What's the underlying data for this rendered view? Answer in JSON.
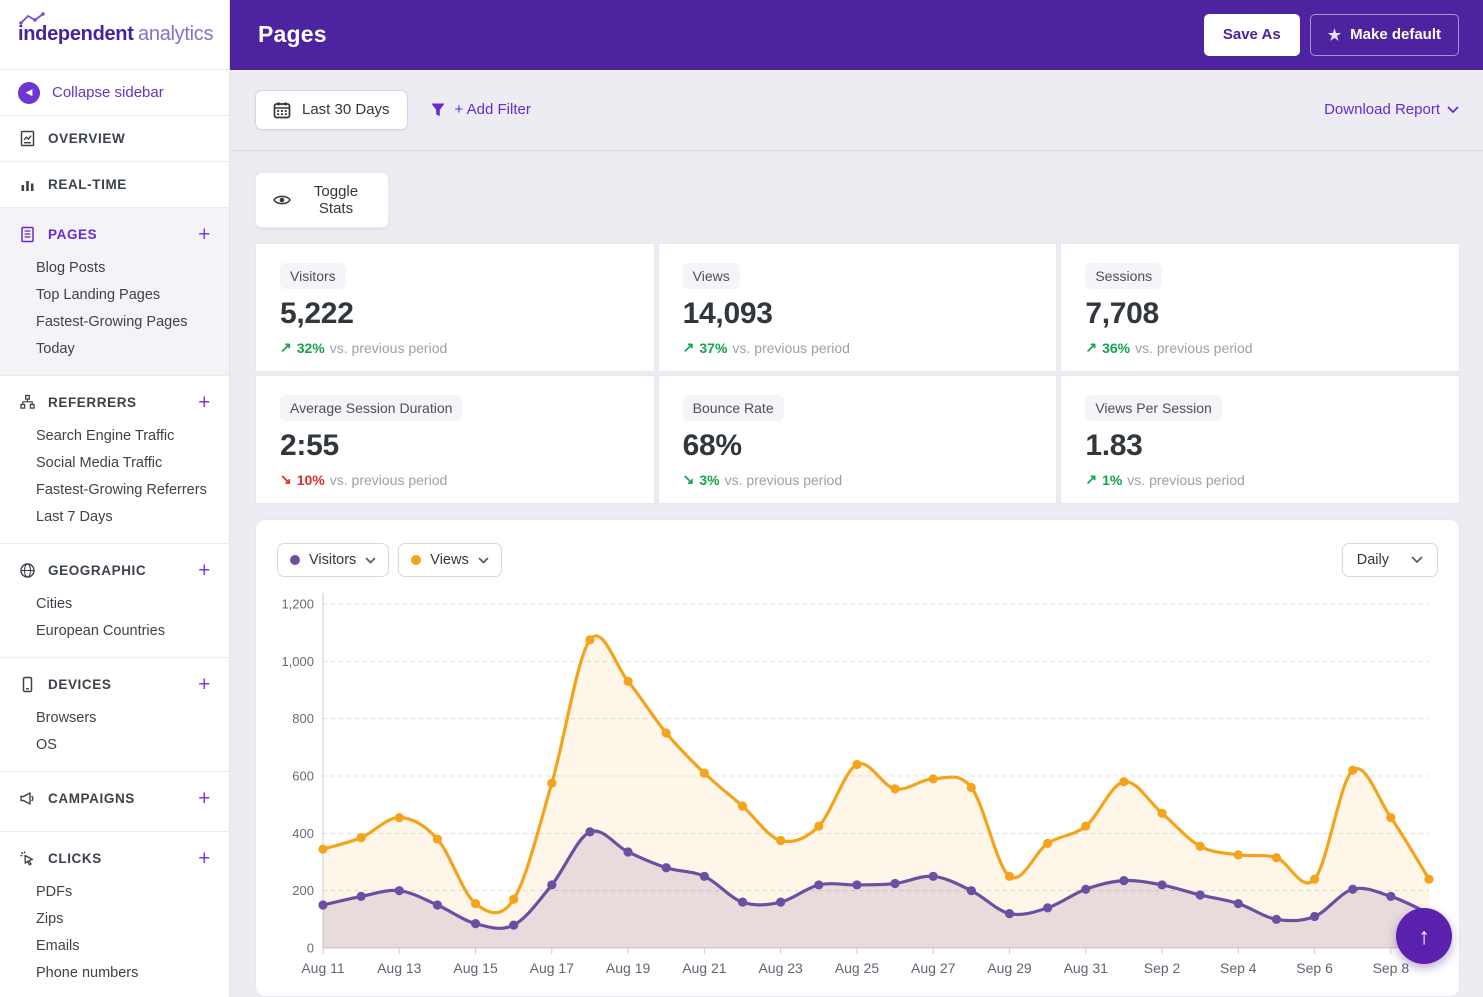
{
  "colors": {
    "header_bg": "#4d23a0",
    "accent_purple": "#6929d4",
    "fab_purple": "#5a21ad",
    "green": "#16a34a",
    "red": "#dc2f26"
  },
  "brand": {
    "name_bold": "independent",
    "name_light": "analytics"
  },
  "sidebar": {
    "collapse_label": "Collapse sidebar",
    "sections": [
      {
        "label": "OVERVIEW",
        "items": []
      },
      {
        "label": "REAL-TIME",
        "items": []
      },
      {
        "label": "PAGES",
        "plus": "+",
        "items": [
          "Blog Posts",
          "Top Landing Pages",
          "Fastest-Growing Pages",
          "Today"
        ]
      },
      {
        "label": "REFERRERS",
        "plus": "+",
        "items": [
          "Search Engine Traffic",
          "Social Media Traffic",
          "Fastest-Growing Referrers",
          "Last 7 Days"
        ]
      },
      {
        "label": "GEOGRAPHIC",
        "plus": "+",
        "items": [
          "Cities",
          "European Countries"
        ]
      },
      {
        "label": "DEVICES",
        "plus": "+",
        "items": [
          "Browsers",
          "OS"
        ]
      },
      {
        "label": "CAMPAIGNS",
        "plus": "+",
        "items": []
      },
      {
        "label": "CLICKS",
        "plus": "+",
        "items": [
          "PDFs",
          "Zips",
          "Emails",
          "Phone numbers"
        ]
      }
    ]
  },
  "header": {
    "title": "Pages",
    "save_as": "Save As",
    "make_default": "Make default"
  },
  "filter_bar": {
    "date_range": "Last 30 Days",
    "add_filter": "+ Add Filter",
    "download_report": "Download Report"
  },
  "toggle_stats_label": "Toggle Stats",
  "stats": [
    {
      "label": "Visitors",
      "value": "5,222",
      "arrow": "↗",
      "change": "32%",
      "suffix": "vs. previous period",
      "trend_color": "#16a34a"
    },
    {
      "label": "Views",
      "value": "14,093",
      "arrow": "↗",
      "change": "37%",
      "suffix": "vs. previous period",
      "trend_color": "#16a34a"
    },
    {
      "label": "Sessions",
      "value": "7,708",
      "arrow": "↗",
      "change": "36%",
      "suffix": "vs. previous period",
      "trend_color": "#16a34a"
    },
    {
      "label": "Average Session Duration",
      "value": "2:55",
      "arrow": "↘",
      "change": "10%",
      "suffix": "vs. previous period",
      "trend_color": "#dc2f26"
    },
    {
      "label": "Bounce Rate",
      "value": "68%",
      "arrow": "↘",
      "change": "3%",
      "suffix": "vs. previous period",
      "trend_color": "#16a34a"
    },
    {
      "label": "Views Per Session",
      "value": "1.83",
      "arrow": "↗",
      "change": "1%",
      "suffix": "vs. previous period",
      "trend_color": "#16a34a"
    }
  ],
  "chart_controls": {
    "interval": "Daily"
  },
  "chart_data": {
    "type": "area",
    "title": "",
    "interval": "Daily",
    "x": [
      "Aug 11",
      "Aug 12",
      "Aug 13",
      "Aug 14",
      "Aug 15",
      "Aug 16",
      "Aug 17",
      "Aug 18",
      "Aug 19",
      "Aug 20",
      "Aug 21",
      "Aug 22",
      "Aug 23",
      "Aug 24",
      "Aug 25",
      "Aug 26",
      "Aug 27",
      "Aug 28",
      "Aug 29",
      "Aug 30",
      "Aug 31",
      "Sep 1",
      "Sep 2",
      "Sep 3",
      "Sep 4",
      "Sep 5",
      "Sep 6",
      "Sep 7",
      "Sep 8",
      "Sep 9"
    ],
    "x_ticks_every": 2,
    "series": [
      {
        "name": "Visitors",
        "color": "#6d4fa1",
        "fill": "rgba(109,79,161,0.16)",
        "values": [
          150,
          180,
          200,
          150,
          85,
          80,
          220,
          405,
          335,
          280,
          250,
          160,
          160,
          220,
          220,
          225,
          250,
          200,
          120,
          140,
          205,
          235,
          220,
          185,
          155,
          100,
          110,
          205,
          180,
          120
        ]
      },
      {
        "name": "Views",
        "color": "#f5a31b",
        "fill": "rgba(245,163,27,0.10)",
        "values": [
          345,
          385,
          455,
          380,
          155,
          170,
          575,
          1075,
          930,
          750,
          610,
          495,
          375,
          425,
          640,
          555,
          590,
          560,
          250,
          365,
          425,
          580,
          470,
          355,
          325,
          315,
          240,
          620,
          455,
          240
        ]
      }
    ],
    "ylim": [
      0,
      1200
    ],
    "ytick_values": [
      0,
      200,
      400,
      600,
      800,
      1000,
      1200
    ],
    "ytick_labels": [
      "0",
      "200",
      "400",
      "600",
      "800",
      "1,000",
      "1,200"
    ],
    "grid": true,
    "legend_position": "top-left"
  }
}
